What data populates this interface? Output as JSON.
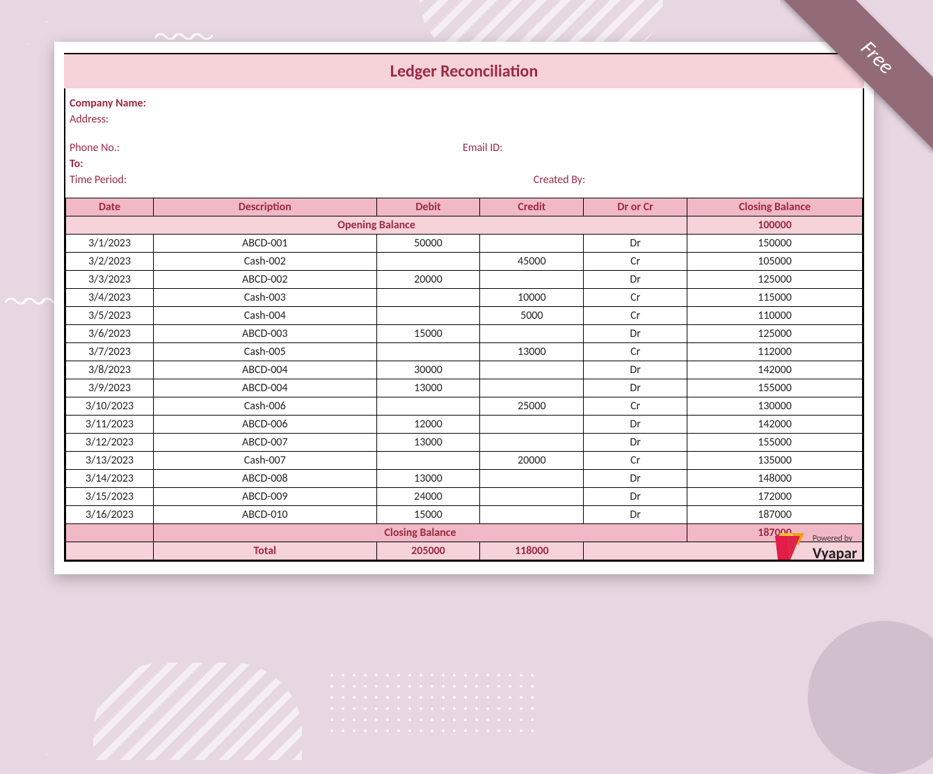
{
  "ribbon": {
    "text": "Free"
  },
  "title": "Ledger Reconciliation",
  "meta": {
    "company_label": "Company Name:",
    "address_label": "Address:",
    "phone_label": "Phone No.:",
    "email_label": "Email ID:",
    "to_label": "To:",
    "time_period_label": "Time Period:",
    "created_by_label": "Created By:"
  },
  "table": {
    "headers": {
      "date": "Date",
      "description": "Description",
      "debit": "Debit",
      "credit": "Credit",
      "drcr": "Dr or Cr",
      "closing": "Closing Balance"
    },
    "opening_label": "Opening Balance",
    "opening_value": "100000",
    "closing_label": "Closing Balance",
    "closing_value": "187000",
    "total_label": "Total",
    "total_debit": "205000",
    "total_credit": "118000",
    "rows": [
      {
        "date": "3/1/2023",
        "desc": "ABCD-001",
        "debit": "50000",
        "credit": "",
        "drcr": "Dr",
        "bal": "150000"
      },
      {
        "date": "3/2/2023",
        "desc": "Cash-002",
        "debit": "",
        "credit": "45000",
        "drcr": "Cr",
        "bal": "105000"
      },
      {
        "date": "3/3/2023",
        "desc": "ABCD-002",
        "debit": "20000",
        "credit": "",
        "drcr": "Dr",
        "bal": "125000"
      },
      {
        "date": "3/4/2023",
        "desc": "Cash-003",
        "debit": "",
        "credit": "10000",
        "drcr": "Cr",
        "bal": "115000"
      },
      {
        "date": "3/5/2023",
        "desc": "Cash-004",
        "debit": "",
        "credit": "5000",
        "drcr": "Cr",
        "bal": "110000"
      },
      {
        "date": "3/6/2023",
        "desc": "ABCD-003",
        "debit": "15000",
        "credit": "",
        "drcr": "Dr",
        "bal": "125000"
      },
      {
        "date": "3/7/2023",
        "desc": "Cash-005",
        "debit": "",
        "credit": "13000",
        "drcr": "Cr",
        "bal": "112000"
      },
      {
        "date": "3/8/2023",
        "desc": "ABCD-004",
        "debit": "30000",
        "credit": "",
        "drcr": "Dr",
        "bal": "142000"
      },
      {
        "date": "3/9/2023",
        "desc": "ABCD-004",
        "debit": "13000",
        "credit": "",
        "drcr": "Dr",
        "bal": "155000"
      },
      {
        "date": "3/10/2023",
        "desc": "Cash-006",
        "debit": "",
        "credit": "25000",
        "drcr": "Cr",
        "bal": "130000"
      },
      {
        "date": "3/11/2023",
        "desc": "ABCD-006",
        "debit": "12000",
        "credit": "",
        "drcr": "Dr",
        "bal": "142000"
      },
      {
        "date": "3/12/2023",
        "desc": "ABCD-007",
        "debit": "13000",
        "credit": "",
        "drcr": "Dr",
        "bal": "155000"
      },
      {
        "date": "3/13/2023",
        "desc": "Cash-007",
        "debit": "",
        "credit": "20000",
        "drcr": "Cr",
        "bal": "135000"
      },
      {
        "date": "3/14/2023",
        "desc": "ABCD-008",
        "debit": "13000",
        "credit": "",
        "drcr": "Dr",
        "bal": "148000"
      },
      {
        "date": "3/15/2023",
        "desc": "ABCD-009",
        "debit": "24000",
        "credit": "",
        "drcr": "Dr",
        "bal": "172000"
      },
      {
        "date": "3/16/2023",
        "desc": "ABCD-010",
        "debit": "15000",
        "credit": "",
        "drcr": "Dr",
        "bal": "187000"
      }
    ]
  },
  "branding": {
    "powered_label": "Powered by",
    "brand_name": "Vyapar"
  },
  "colors": {
    "accent": "#9a2a43",
    "band_light": "#f6d2d9",
    "band_dark": "#f1b9c5",
    "ribbon": "#926b77"
  }
}
